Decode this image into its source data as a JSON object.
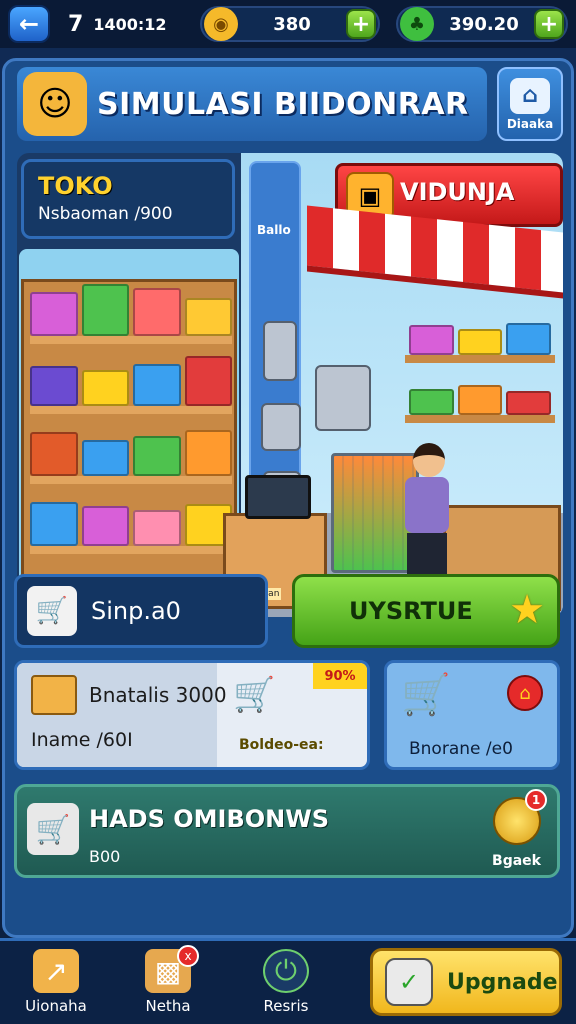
{
  "topbar": {
    "level": "7",
    "xp": "1400:12",
    "coins": "380",
    "gems": "390.20"
  },
  "header": {
    "title": "SIMULASI BIIDONRAR",
    "badge_label": "Diaaka"
  },
  "store": {
    "name": "TOKO",
    "subtitle": "Nsbaoman /900",
    "side_panel_label": "Ballo",
    "sign_text": "VIDUNJA",
    "counter_label": "Gambaran"
  },
  "sim": {
    "label": "Sinp.a0",
    "action_label": "UYSRTUE"
  },
  "product": {
    "name": "Bnatalis 3000",
    "subtitle": "Iname /60I",
    "image_label": "Boldeo-ea:",
    "tag": "90%"
  },
  "cart": {
    "label": "Bnorane /e0"
  },
  "bonus": {
    "title": "HADS OMIBONWS",
    "subtitle": "B00",
    "coin_label": "Bgaek",
    "count": "1"
  },
  "nav": [
    {
      "label": "Uionaha",
      "icon": "box-arrow-icon"
    },
    {
      "label": "Netha",
      "icon": "crate-icon",
      "badge": "x"
    },
    {
      "label": "Resris",
      "icon": "power-icon"
    }
  ],
  "upgrade_label": "Upgnade",
  "colors": {
    "accent_green": "#45a317",
    "accent_red": "#e52a2a",
    "accent_yellow": "#ffd21f",
    "panel_blue": "#1b4d8a"
  }
}
